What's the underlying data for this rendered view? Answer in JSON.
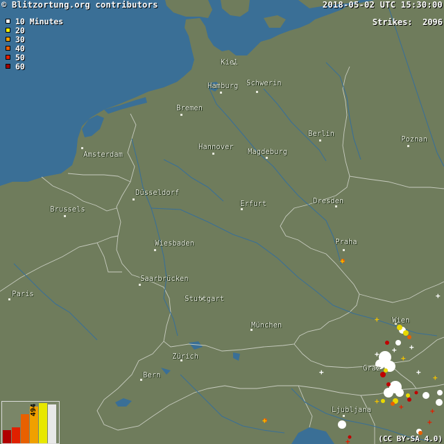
{
  "header": {
    "attribution": "© Blitzortung.org contributors",
    "timestamp": "2018-05-02 UTC 15:30:00"
  },
  "legend": {
    "title": "10 Minutes",
    "items": [
      {
        "label": "20",
        "color": "#f0f000"
      },
      {
        "label": "30",
        "color": "#f0a000"
      },
      {
        "label": "40",
        "color": "#e86000"
      },
      {
        "label": "50",
        "color": "#e02000"
      },
      {
        "label": "60",
        "color": "#a00000"
      }
    ],
    "first_color": "#ffffff"
  },
  "strikes": {
    "label": "Strikes:",
    "value": "2096"
  },
  "histogram": {
    "values": [
      180,
      210,
      390,
      494,
      540,
      520
    ],
    "colors": [
      "#b00000",
      "#e02000",
      "#e86000",
      "#f0a000",
      "#e8e800",
      "#e8e8e8"
    ],
    "highlight_label": "494"
  },
  "license": "(CC BY-SA 4.0)",
  "colors": {
    "sea": "#3a6f96",
    "land": "#6f7c5c",
    "border": "#c8ccc0",
    "river": "#3a6f96"
  },
  "cities": [
    {
      "name": "Kiel"
    },
    {
      "name": "Hamburg"
    },
    {
      "name": "Schwerin"
    },
    {
      "name": "Bremen"
    },
    {
      "name": "Berlin"
    },
    {
      "name": "Poznan"
    },
    {
      "name": "Amsterdam"
    },
    {
      "name": "Hannover"
    },
    {
      "name": "Magdeburg"
    },
    {
      "name": "Düsseldorf"
    },
    {
      "name": "Brussels"
    },
    {
      "name": "Erfurt"
    },
    {
      "name": "Dresden"
    },
    {
      "name": "Praha"
    },
    {
      "name": "Wiesbaden"
    },
    {
      "name": "Saarbrücken"
    },
    {
      "name": "Paris"
    },
    {
      "name": "Stuttgart"
    },
    {
      "name": "München"
    },
    {
      "name": "Wien"
    },
    {
      "name": "Zürich"
    },
    {
      "name": "Bern"
    },
    {
      "name": "Graz"
    },
    {
      "name": "Ljubljana"
    }
  ]
}
